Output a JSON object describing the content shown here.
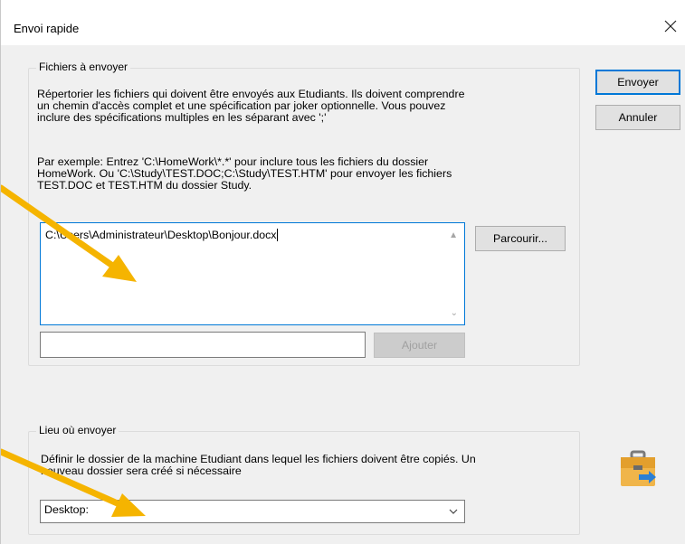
{
  "window": {
    "title": "Envoi rapide",
    "close_icon": "close-icon"
  },
  "files_group": {
    "legend": "Fichiers à envoyer",
    "description_lines": [
      "Répertorier les fichiers qui doivent être envoyés aux Etudiants. Ils doivent comprendre",
      "un chemin d'accès complet et une spécification par joker optionnelle. Vous pouvez",
      "inclure des spécifications multiples en les séparant avec ';'"
    ],
    "example_lines": [
      "Par exemple: Entrez 'C:\\HomeWork\\*.*' pour inclure tous les fichiers du dossier",
      "HomeWork. Ou 'C:\\Study\\TEST.DOC;C:\\Study\\TEST.HTM' pour envoyer les fichiers",
      "TEST.DOC et TEST.HTM du dossier Study."
    ],
    "file_list_value": "C:\\Users\\Administrateur\\Desktop\\Bonjour.docx",
    "browse_label": "Parcourir...",
    "add_input_value": "",
    "add_label": "Ajouter"
  },
  "destination_group": {
    "legend": "Lieu où envoyer",
    "description_lines": [
      "Définir le dossier de la machine Etudiant dans lequel les fichiers doivent être copiés. Un",
      "nouveau dossier sera créé si nécessaire"
    ],
    "folder_selected": "Desktop:"
  },
  "buttons": {
    "send_label": "Envoyer",
    "cancel_label": "Annuler"
  },
  "annotations": {
    "arrow_color": "#f5b400",
    "icon": "send-folder-icon"
  }
}
